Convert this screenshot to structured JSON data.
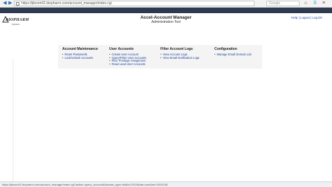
{
  "browser": {
    "url": "https://jibcom01.biopharm.com/account_manager/index.cgi",
    "search_placeholder": "Google",
    "back_glyph": "◀",
    "forward_glyph": "▶",
    "home_glyph": "⌂",
    "skype_glyph": "S",
    "menu_glyph": "≡"
  },
  "header": {
    "logo_text": "BIOPHARM",
    "logo_sub": "Systems",
    "title": "Accel-Account Manager",
    "subtitle": "Administration Tool",
    "help_link": "Help",
    "logout_link": "Logout",
    "logdir_link": "Log Dir",
    "sep": "|"
  },
  "menu": {
    "columns": [
      {
        "title": "Account Maintenance",
        "items": [
          "Reset Passwords",
          "Lock/Unlock Accounts"
        ]
      },
      {
        "title": "User Accounts",
        "items": [
          "Create User Account",
          "Query/Filter User Accounts",
          "RDC Privilege Assignment",
          "Read Lead User Accounts"
        ]
      },
      {
        "title": "Filter Account Logs",
        "items": [
          "View Account Logs",
          "View Email Notification Logs"
        ]
      },
      {
        "title": "Configuration",
        "items": [
          "Manage Email Domain List"
        ]
      }
    ]
  },
  "status": {
    "text": "https://jibcom01.biopharm.com/account_manager/index.cgi?action=query_account&domain_type=list&id=2019&tab=user&ref=2000138"
  }
}
